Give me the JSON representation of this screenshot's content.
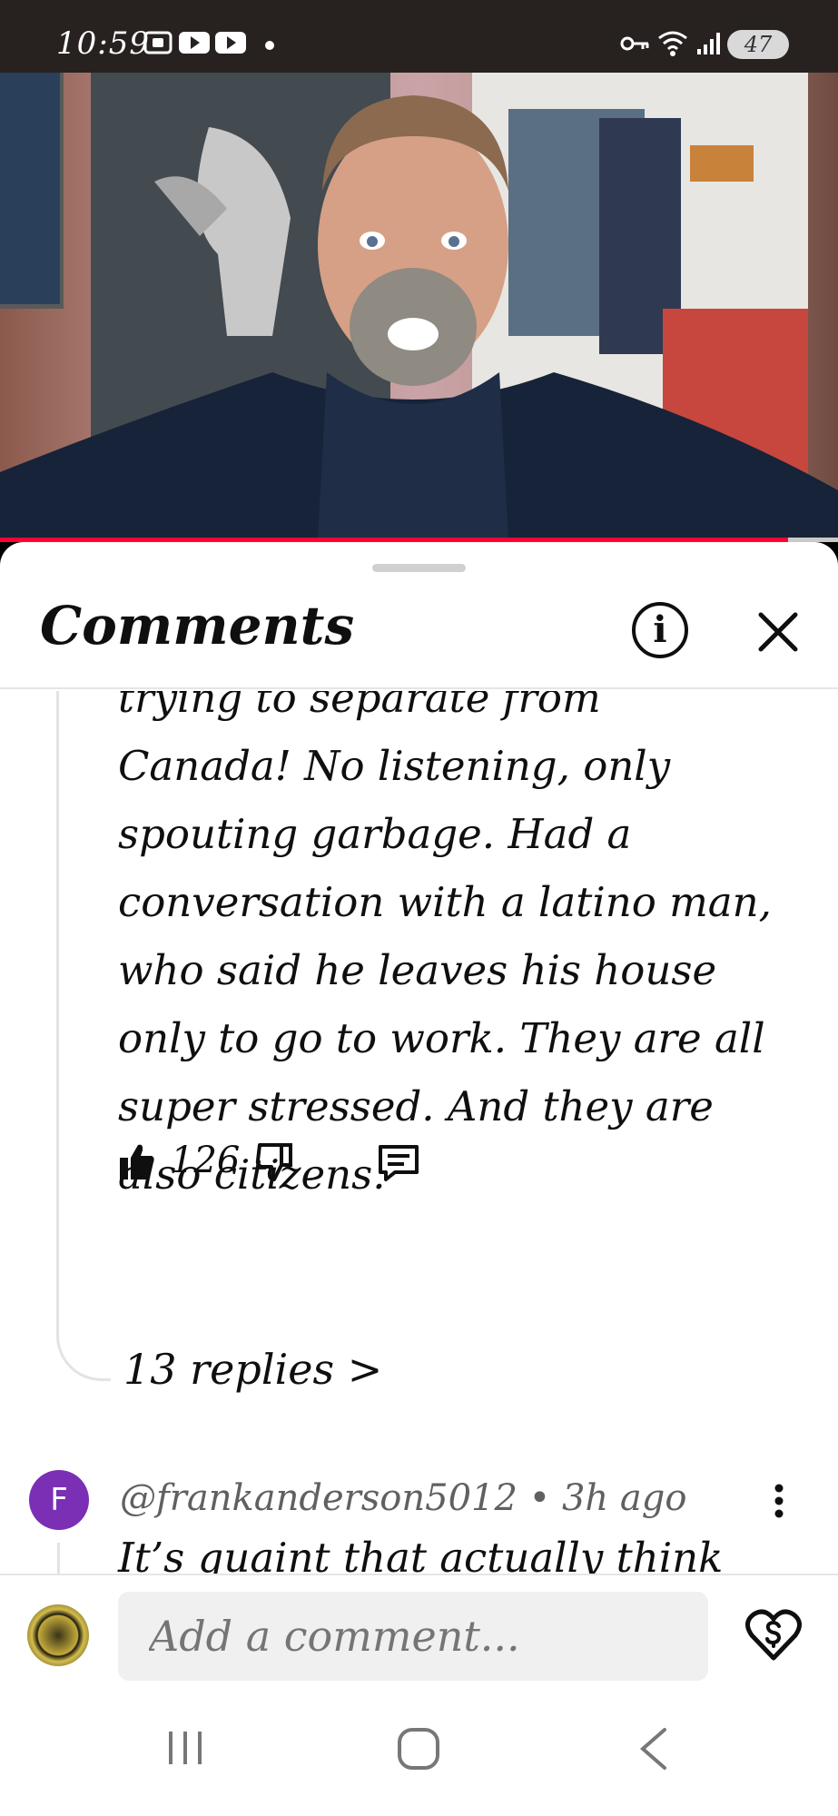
{
  "status_bar": {
    "time": "10:59",
    "battery": "47",
    "icons": [
      "screenshot-icon",
      "youtube-icon",
      "youtube-icon",
      "dot-icon",
      "vpn-key-icon",
      "wifi-icon",
      "signal-icon",
      "battery-icon"
    ]
  },
  "video": {
    "progress": 0.94,
    "progress_color": "#ff0033"
  },
  "sheet": {
    "title": "Comments",
    "info_icon": "info-icon",
    "close_icon": "close-icon"
  },
  "comment1": {
    "text": "trying to separate from Canada!  No listening, only spouting garbage.  Had a conversation with a latino man, who said he leaves his house only to go to work.  They are all super stressed.  And they are also citizens.",
    "like_count": "126",
    "replies_label": "13 replies >"
  },
  "comment2": {
    "avatar_letter": "F",
    "avatar_color": "#7b2fb5",
    "meta": "@frankanderson5012 • 3h ago",
    "text": "It’s quaint that actually think"
  },
  "composer": {
    "placeholder": "Add a comment..."
  },
  "nav": {
    "icons": [
      "recent-apps-icon",
      "home-icon",
      "back-icon"
    ]
  }
}
